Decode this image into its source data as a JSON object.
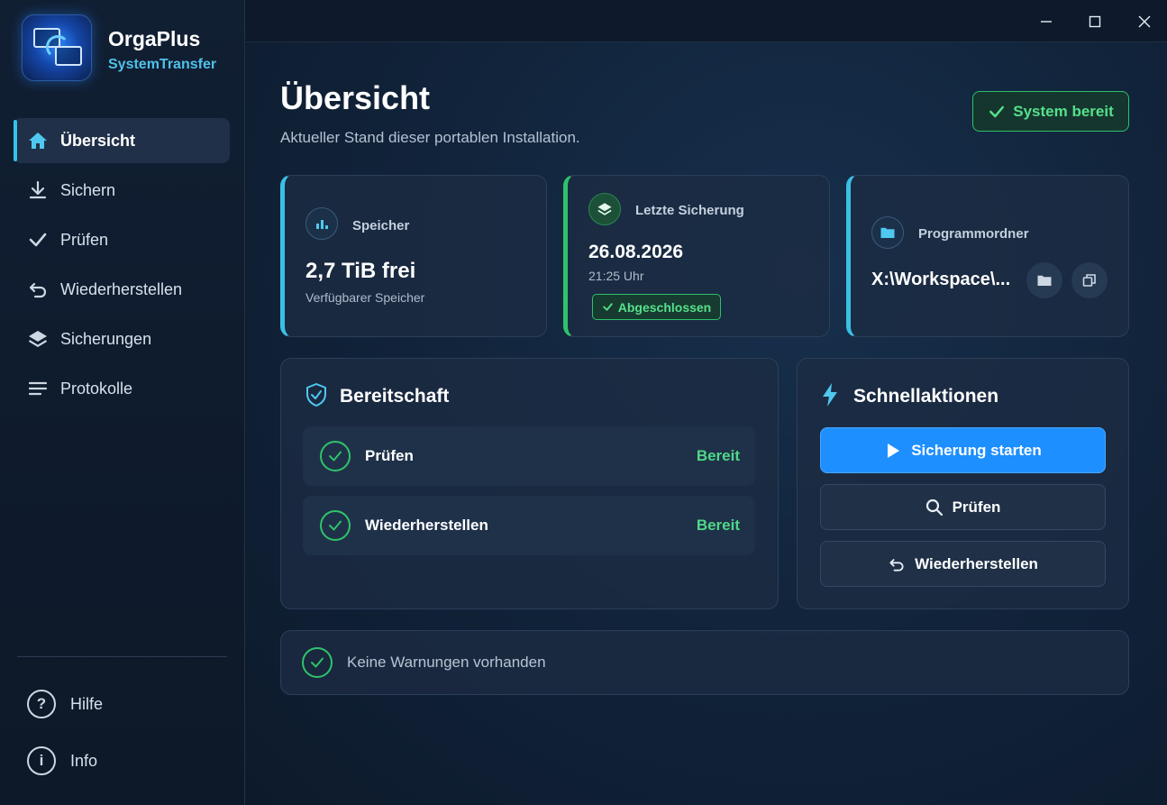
{
  "app": {
    "name": "OrgaPlus",
    "subtitle": "SystemTransfer"
  },
  "sidebar": {
    "items": [
      {
        "label": "Übersicht",
        "icon": "home-icon",
        "active": true
      },
      {
        "label": "Sichern",
        "icon": "download-icon",
        "active": false
      },
      {
        "label": "Prüfen",
        "icon": "check-icon",
        "active": false
      },
      {
        "label": "Wiederherstellen",
        "icon": "undo-icon",
        "active": false
      },
      {
        "label": "Sicherungen",
        "icon": "layers-icon",
        "active": false
      },
      {
        "label": "Protokolle",
        "icon": "list-icon",
        "active": false
      }
    ],
    "bottom": [
      {
        "label": "Hilfe",
        "glyph": "?",
        "icon": "help-icon"
      },
      {
        "label": "Info",
        "glyph": "i",
        "icon": "info-icon"
      }
    ]
  },
  "header": {
    "title": "Übersicht",
    "subtitle": "Aktueller Stand dieser portablen Installation.",
    "status": "System bereit"
  },
  "cards": {
    "storage": {
      "label": "Speicher",
      "value": "2,7 TiB frei",
      "caption": "Verfügbarer Speicher"
    },
    "last_backup": {
      "label": "Letzte Sicherung",
      "date": "26.08.2026",
      "time": "21:25 Uhr",
      "badge": "Abgeschlossen"
    },
    "program_folder": {
      "label": "Programmordner",
      "path": "X:\\Workspace\\..."
    }
  },
  "readiness": {
    "title": "Bereitschaft",
    "rows": [
      {
        "name": "Prüfen",
        "state": "Bereit"
      },
      {
        "name": "Wiederherstellen",
        "state": "Bereit"
      }
    ]
  },
  "quick_actions": {
    "title": "Schnellaktionen",
    "start_backup": "Sicherung starten",
    "check": "Prüfen",
    "restore": "Wiederherstellen"
  },
  "warnings": {
    "text": "Keine Warnungen vorhanden"
  },
  "colors": {
    "accent": "#3bbfe6",
    "success": "#2ec46a",
    "primary_button": "#1e8fff",
    "background": "#0e1a2b"
  }
}
